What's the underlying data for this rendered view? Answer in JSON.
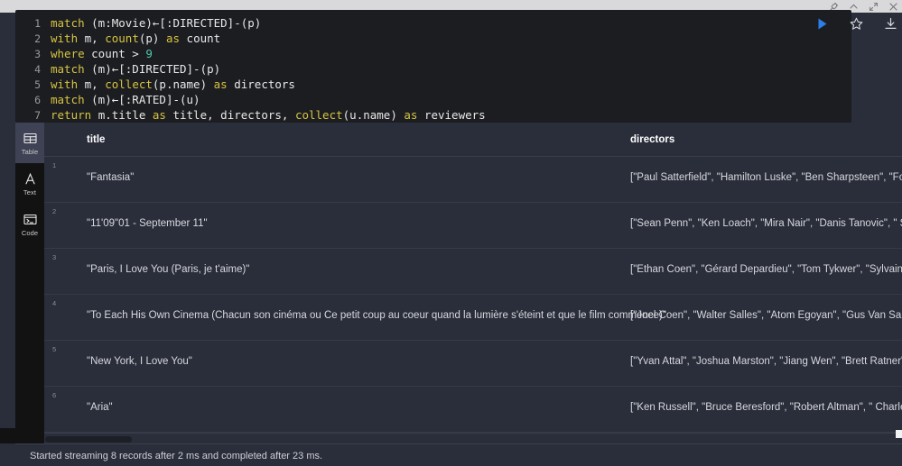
{
  "titlebar": {
    "icons": [
      {
        "name": "pin-icon",
        "label": "Pin"
      },
      {
        "name": "chevron-up-icon",
        "label": "Collapse"
      },
      {
        "name": "expand-icon",
        "label": "Expand"
      },
      {
        "name": "close-icon",
        "label": "Close"
      }
    ]
  },
  "editor": {
    "language": "cypher",
    "lines": [
      {
        "n": "1",
        "tokens": [
          {
            "t": "match ",
            "c": "kw"
          },
          {
            "t": "(m:Movie)←[:DIRECTED]-(p)",
            "c": "pl"
          }
        ]
      },
      {
        "n": "2",
        "tokens": [
          {
            "t": "with ",
            "c": "kw"
          },
          {
            "t": "m, ",
            "c": "pl"
          },
          {
            "t": "count",
            "c": "fn"
          },
          {
            "t": "(p) ",
            "c": "pl"
          },
          {
            "t": "as ",
            "c": "kw"
          },
          {
            "t": "count",
            "c": "pl"
          }
        ]
      },
      {
        "n": "3",
        "tokens": [
          {
            "t": "where ",
            "c": "kw"
          },
          {
            "t": "count > ",
            "c": "pl"
          },
          {
            "t": "9",
            "c": "num"
          }
        ]
      },
      {
        "n": "4",
        "tokens": [
          {
            "t": "match ",
            "c": "kw"
          },
          {
            "t": "(m)←[:DIRECTED]-(p)",
            "c": "pl"
          }
        ]
      },
      {
        "n": "5",
        "tokens": [
          {
            "t": "with ",
            "c": "kw"
          },
          {
            "t": "m, ",
            "c": "pl"
          },
          {
            "t": "collect",
            "c": "fn"
          },
          {
            "t": "(p.name) ",
            "c": "pl"
          },
          {
            "t": "as ",
            "c": "kw"
          },
          {
            "t": "directors",
            "c": "pl"
          }
        ]
      },
      {
        "n": "6",
        "tokens": [
          {
            "t": "match ",
            "c": "kw"
          },
          {
            "t": "(m)←[:RATED]-(u)",
            "c": "pl"
          }
        ]
      },
      {
        "n": "7",
        "tokens": [
          {
            "t": "return ",
            "c": "kw"
          },
          {
            "t": "m.title ",
            "c": "pl"
          },
          {
            "t": "as ",
            "c": "kw"
          },
          {
            "t": "title, directors, ",
            "c": "pl"
          },
          {
            "t": "collect",
            "c": "fn"
          },
          {
            "t": "(u.name) ",
            "c": "pl"
          },
          {
            "t": "as ",
            "c": "kw"
          },
          {
            "t": "reviewers",
            "c": "pl"
          }
        ]
      }
    ],
    "actions": [
      {
        "name": "run-query-button",
        "label": "Run"
      },
      {
        "name": "favorite-star-button",
        "label": "Save as favorite"
      },
      {
        "name": "download-button",
        "label": "Download"
      }
    ],
    "accent_color": "#2a7fe8"
  },
  "result_sidebar": {
    "items": [
      {
        "name": "sidebar-item-table",
        "label": "Table",
        "icon": "table-icon",
        "active": true
      },
      {
        "name": "sidebar-item-text",
        "label": "Text",
        "icon": "text-icon",
        "active": false
      },
      {
        "name": "sidebar-item-code",
        "label": "Code",
        "icon": "code-icon",
        "active": false
      }
    ]
  },
  "table": {
    "columns": [
      {
        "key": "title",
        "label": "title"
      },
      {
        "key": "directors",
        "label": "directors"
      }
    ],
    "rows": [
      {
        "idx": "1",
        "title": "\"Fantasia\"",
        "directors": "[\"Paul Satterfield\", \"Hamilton Luske\", \"Ben Sharpsteen\", \"Ford"
      },
      {
        "idx": "2",
        "title": "\"11'09\"01 - September 11\"",
        "directors": "[\"Sean Penn\", \"Ken Loach\", \"Mira Nair\", \"Danis Tanovic\", \" Sa"
      },
      {
        "idx": "3",
        "title": "\"Paris, I Love You (Paris, je t'aime)\"",
        "directors": "[\"Ethan Coen\", \"Gérard Depardieu\", \"Tom Tykwer\", \"Sylvain Ch"
      },
      {
        "idx": "4",
        "title": "\"To Each His Own Cinema (Chacun son cinéma ou Ce petit coup au coeur quand la lumière s'éteint et que le film commence)\"",
        "directors": "[\"Joel Coen\", \"Walter Salles\", \"Atom Egoyan\", \"Gus Van Sant\""
      },
      {
        "idx": "5",
        "title": "\"New York, I Love You\"",
        "directors": "[\"Yvan Attal\", \"Joshua Marston\", \"Jiang Wen\", \"Brett Ratner\", \""
      },
      {
        "idx": "6",
        "title": "\"Aria\"",
        "directors": "[\"Ken Russell\", \"Bruce Beresford\", \"Robert Altman\", \" Charles"
      }
    ]
  },
  "status": {
    "message": "Started streaming 8 records after 2 ms and completed after 23 ms."
  }
}
